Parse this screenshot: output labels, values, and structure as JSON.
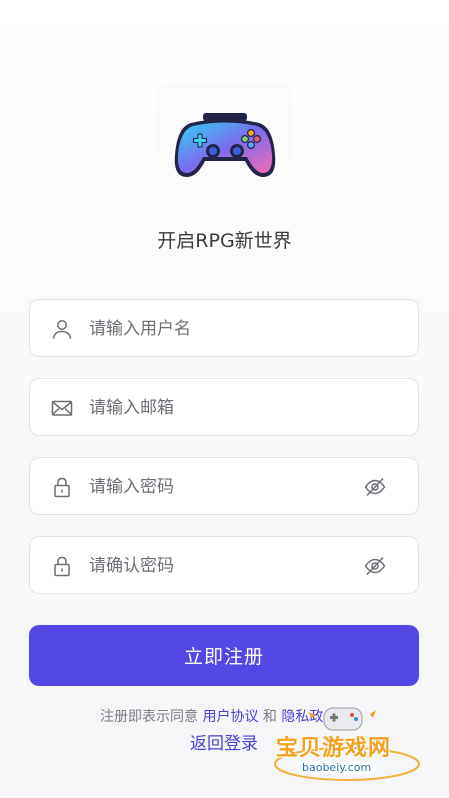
{
  "app": {
    "tagline": "开启RPG新世界",
    "accent_color": "#5347e6",
    "logo_icon": "gamepad-icon"
  },
  "form": {
    "username": {
      "placeholder": "请输入用户名",
      "icon": "user-icon"
    },
    "email": {
      "placeholder": "请输入邮箱",
      "icon": "mail-icon"
    },
    "password": {
      "placeholder": "请输入密码",
      "icon": "lock-icon",
      "toggle_icon": "eye-off-icon"
    },
    "confirm_password": {
      "placeholder": "请确认密码",
      "icon": "lock-icon",
      "toggle_icon": "eye-off-icon"
    }
  },
  "actions": {
    "register_label": "立即注册",
    "back_to_login_label": "返回登录"
  },
  "agreement": {
    "prefix": "注册即表示同意",
    "user_agreement": "用户协议",
    "and": "和",
    "privacy_policy": "隐私政"
  },
  "watermark": {
    "brand": "宝贝游戏网",
    "url": "baobeiy.com"
  }
}
